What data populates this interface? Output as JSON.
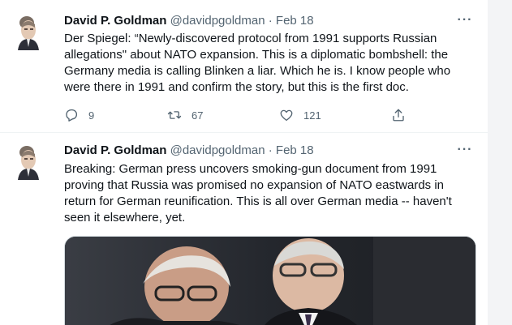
{
  "tweets": [
    {
      "author_name": "David P. Goldman",
      "handle": "@davidpgoldman",
      "separator": "·",
      "date": "Feb 18",
      "text_lines": [
        "Der Spiegel: “Newly-discovered protocol from 1991 supports Russian",
        "allegations\" about NATO expansion. This is a diplomatic bombshell: the",
        "Germany media is calling Blinken a liar. Which he is. I know people who",
        "were there in 1991 and confirm the story, but this is the first doc."
      ],
      "replies": "9",
      "retweets": "67",
      "likes": "121",
      "icons": [
        "reply-icon",
        "retweet-icon",
        "like-icon",
        "share-icon",
        "more-icon"
      ]
    },
    {
      "author_name": "David P. Goldman",
      "handle": "@davidpgoldman",
      "separator": "·",
      "date": "Feb 18",
      "text_lines": [
        "Breaking: German press uncovers smoking-gun document from 1991",
        "proving that Russia was promised no expansion of NATO eastwards in",
        "return for German reunification. This is all over German media -- haven't",
        "seen it elsewhere, yet."
      ],
      "icons": [
        "more-icon"
      ]
    }
  ],
  "more_label": "···",
  "colors": {
    "text": "#0f1419",
    "secondary": "#536471",
    "divider": "#eff3f4",
    "gutter": "#f3f4f6"
  }
}
